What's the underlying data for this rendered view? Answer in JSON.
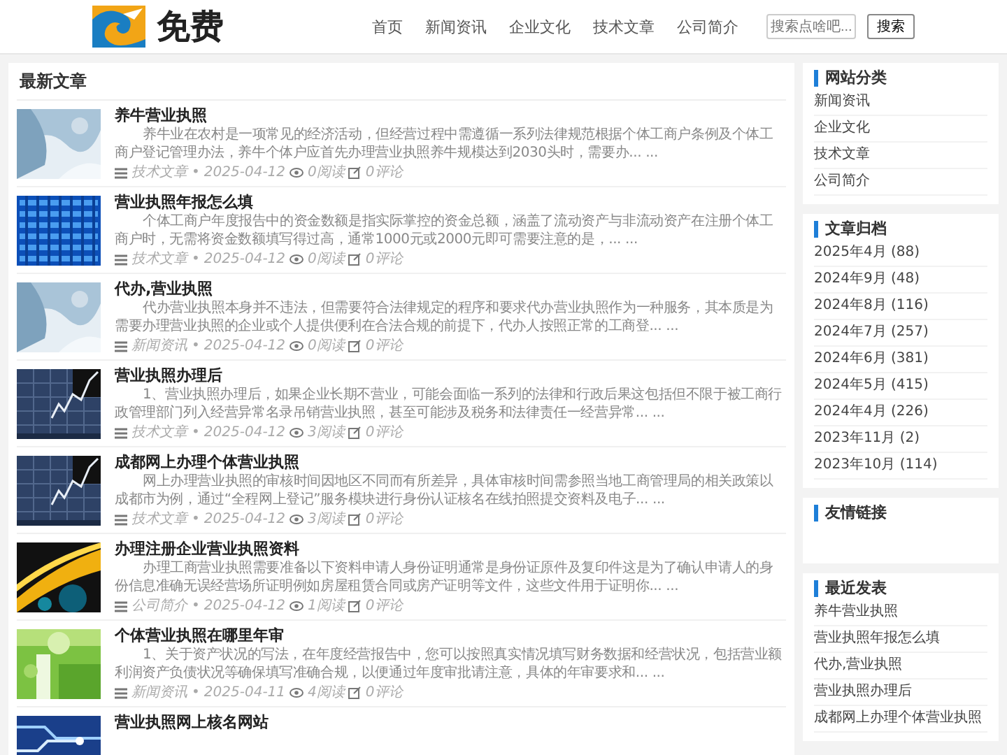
{
  "header": {
    "logo_text": "免费",
    "nav": [
      {
        "label": "首页"
      },
      {
        "label": "新闻资讯"
      },
      {
        "label": "企业文化"
      },
      {
        "label": "技术文章"
      },
      {
        "label": "公司简介"
      }
    ],
    "search": {
      "placeholder": "搜索点啥吧...",
      "button": "搜索"
    }
  },
  "main": {
    "title": "最新文章",
    "articles": [
      {
        "title": "养牛营业执照",
        "summary": "养牛业在农村是一项常见的经济活动，但经营过程中需遵循一系列法律规范根据个体工商户条例及个体工商户登记管理办法，养牛个体户应首先办理营业执照养牛规模达到2030头时，需要办... ...",
        "category": "技术文章",
        "separator": "•",
        "date": "2025-04-12",
        "reads": "0阅读",
        "comments": "0评论"
      },
      {
        "title": "营业执照年报怎么填",
        "summary": "个体工商户年度报告中的资金数额是指实际掌控的资金总额，涵盖了流动资产与非流动资产在注册个体工商户时，无需将资金数额填写得过高，通常1000元或2000元即可需要注意的是，... ...",
        "category": "技术文章",
        "separator": "•",
        "date": "2025-04-12",
        "reads": "0阅读",
        "comments": "0评论"
      },
      {
        "title": "代办,营业执照",
        "summary": "代办营业执照本身并不违法，但需要符合法律规定的程序和要求代办营业执照作为一种服务，其本质是为需要办理营业执照的企业或个人提供便利在合法合规的前提下，代办人按照正常的工商登... ...",
        "category": "新闻资讯",
        "separator": "•",
        "date": "2025-04-12",
        "reads": "0阅读",
        "comments": "0评论"
      },
      {
        "title": "营业执照办理后",
        "summary": "1、营业执照办理后，如果企业长期不营业，可能会面临一系列的法律和行政后果这包括但不限于被工商行政管理部门列入经营异常名录吊销营业执照，甚至可能涉及税务和法律责任一经营异常... ...",
        "category": "技术文章",
        "separator": "•",
        "date": "2025-04-12",
        "reads": "3阅读",
        "comments": "0评论"
      },
      {
        "title": "成都网上办理个体营业执照",
        "summary": "网上办理营业执照的审核时间因地区不同而有所差异，具体审核时间需参照当地工商管理局的相关政策以成都市为例，通过“全程网上登记”服务模块进行身份认证核名在线拍照提交资料及电子... ...",
        "category": "技术文章",
        "separator": "•",
        "date": "2025-04-12",
        "reads": "3阅读",
        "comments": "0评论"
      },
      {
        "title": "办理注册企业营业执照资料",
        "summary": "办理工商营业执照需要准备以下资料申请人身份证明通常是身份证原件及复印件这是为了确认申请人的身份信息准确无误经营场所证明例如房屋租赁合同或房产证明等文件，这些文件用于证明你... ...",
        "category": "公司简介",
        "separator": "•",
        "date": "2025-04-12",
        "reads": "1阅读",
        "comments": "0评论"
      },
      {
        "title": "个体营业执照在哪里年审",
        "summary": "1、关于资产状况的写法，在年度经营报告中，您可以按照真实情况填写财务数据和经营状况，包括营业额利润资产负债状况等确保填写准确合规，以便通过年度审批请注意，具体的年审要求和... ...",
        "category": "新闻资讯",
        "separator": "•",
        "date": "2025-04-11",
        "reads": "4阅读",
        "comments": "0评论"
      },
      {
        "title": "营业执照网上核名网站"
      }
    ]
  },
  "sidebar": [
    {
      "title": "网站分类",
      "items": [
        "新闻资讯",
        "企业文化",
        "技术文章",
        "公司简介"
      ]
    },
    {
      "title": "文章归档",
      "items": [
        "2025年4月 (88)",
        "2024年9月 (48)",
        "2024年8月 (116)",
        "2024年7月 (257)",
        "2024年6月 (381)",
        "2024年5月 (415)",
        "2024年4月 (226)",
        "2023年11月 (2)",
        "2023年10月 (114)"
      ]
    },
    {
      "title": "友情链接"
    },
    {
      "title": "最近发表",
      "items": [
        "养牛营业执照",
        "营业执照年报怎么填",
        "代办,营业执照",
        "营业执照办理后",
        "成都网上办理个体营业执照"
      ]
    }
  ]
}
